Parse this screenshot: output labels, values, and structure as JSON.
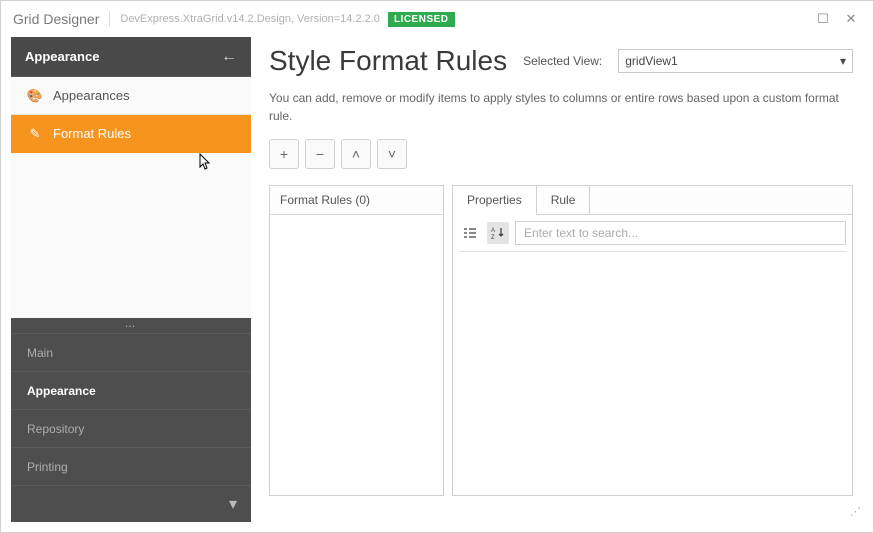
{
  "titlebar": {
    "app_title": "Grid Designer",
    "version_text": "DevExpress.XtraGrid.v14.2.Design, Version=14.2.2.0",
    "license_badge": "LICENSED"
  },
  "sidebar": {
    "header": "Appearance",
    "items": [
      {
        "label": "Appearances",
        "icon": "palette-icon",
        "active": false
      },
      {
        "label": "Format Rules",
        "icon": "edit-icon",
        "active": true
      }
    ],
    "categories": [
      {
        "label": "Main",
        "selected": false
      },
      {
        "label": "Appearance",
        "selected": true
      },
      {
        "label": "Repository",
        "selected": false
      },
      {
        "label": "Printing",
        "selected": false
      }
    ]
  },
  "main": {
    "title": "Style Format Rules",
    "selected_view_label": "Selected View:",
    "selected_view_value": "gridView1",
    "description": "You can add, remove or modify items to apply styles to columns or entire rows based upon a custom format rule.",
    "format_rules_header": "Format Rules (0)",
    "tabs": {
      "properties": "Properties",
      "rule": "Rule"
    },
    "search_placeholder": "Enter text to search..."
  },
  "icons": {
    "palette": "🎨",
    "edit": "✎",
    "back": "←",
    "chevron_down": "▾",
    "chevron_up": "˄",
    "chevron_down_big": "˅",
    "plus": "+",
    "minus": "−",
    "maximize": "☐",
    "close": "✕",
    "sort_cat": "☷",
    "sort_az": "A↓"
  }
}
